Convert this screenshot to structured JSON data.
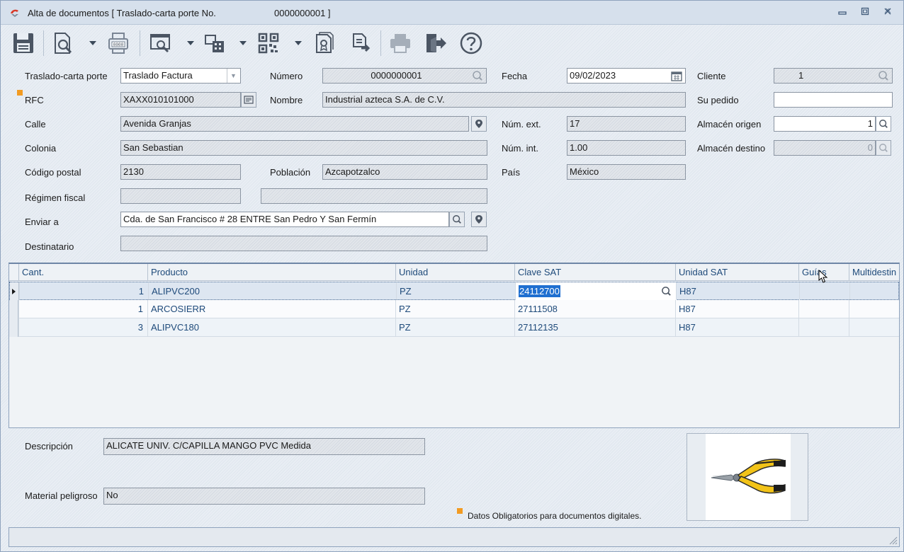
{
  "window": {
    "title": "Alta de documentos [ Traslado-carta porte No.",
    "title_number": "0000000001 ]",
    "controls": [
      "minimize",
      "restore",
      "close"
    ]
  },
  "toolbar": {
    "buttons": [
      "save-icon",
      "preview-document-icon",
      "print-numbered-icon",
      "print-preview-icon",
      "building-tool-icon",
      "qr-code-icon",
      "document-stamp-icon",
      "document-export-icon",
      "printer-icon",
      "exit-icon",
      "help-icon"
    ]
  },
  "form": {
    "traslado_label": "Traslado-carta porte",
    "traslado_value": "Traslado Factura",
    "numero_label": "Número",
    "numero_value": "0000000001",
    "fecha_label": "Fecha",
    "fecha_value": "09/02/2023",
    "cliente_label": "Cliente",
    "cliente_value": "1",
    "rfc_label": "RFC",
    "rfc_value": "XAXX010101000",
    "nombre_label": "Nombre",
    "nombre_value": "Industrial azteca S.A. de C.V.",
    "su_pedido_label": "Su pedido",
    "su_pedido_value": "",
    "calle_label": "Calle",
    "calle_value": "Avenida Granjas",
    "num_ext_label": "Núm. ext.",
    "num_ext_value": "17",
    "almacen_origen_label": "Almacén origen",
    "almacen_origen_value": "1",
    "colonia_label": "Colonia",
    "colonia_value": "San Sebastian",
    "num_int_label": "Núm. int.",
    "num_int_value": "1.00",
    "almacen_destino_label": "Almacén destino",
    "almacen_destino_value": "0",
    "cp_label": "Código postal",
    "cp_value": "2130",
    "poblacion_label": "Población",
    "poblacion_value": "Azcapotzalco",
    "pais_label": "País",
    "pais_value": "México",
    "regimen_label": "Régimen fiscal",
    "regimen_value": "",
    "regimen_desc": "",
    "enviar_label": "Enviar a",
    "enviar_value": "Cda. de San Francisco # 28 ENTRE San Pedro Y San Fermín",
    "destinatario_label": "Destinatario",
    "destinatario_value": ""
  },
  "grid": {
    "columns": [
      "Cant.",
      "Producto",
      "Unidad",
      "Clave SAT",
      "Unidad SAT",
      "Guías",
      "Multidestin"
    ],
    "rows": [
      {
        "cant": "1",
        "producto": "ALIPVC200",
        "unidad": "PZ",
        "clave": "24112700",
        "unidad_sat": "H87"
      },
      {
        "cant": "1",
        "producto": "ARCOSIERR",
        "unidad": "PZ",
        "clave": "27111508",
        "unidad_sat": "H87"
      },
      {
        "cant": "3",
        "producto": "ALIPVC180",
        "unidad": "PZ",
        "clave": "27112135",
        "unidad_sat": "H87"
      }
    ]
  },
  "details": {
    "descripcion_label": "Descripción",
    "descripcion_value": "ALICATE UNIV. C/CAPILLA MANGO PVC Medida",
    "material_label": "Material peligroso",
    "material_value": "No",
    "legend": "Datos Obligatorios para documentos digitales."
  },
  "colors": {
    "accent": "#f29b22",
    "selection": "#1f6fd0",
    "grid_text": "#1e4a7a"
  }
}
